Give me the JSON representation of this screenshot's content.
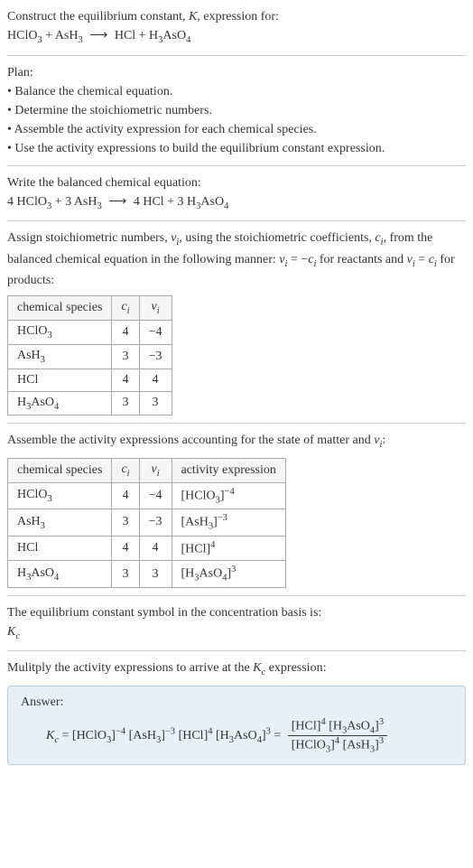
{
  "header": {
    "line1": "Construct the equilibrium constant, ",
    "K": "K",
    "line1b": ", expression for:",
    "eq_lhs": "HClO",
    "eq_sub1": "3",
    "eq_plus1": " + AsH",
    "eq_sub2": "3",
    "arrow": "⟶",
    "eq_rhs1": "HCl + H",
    "eq_sub3": "3",
    "eq_rhs2": "AsO",
    "eq_sub4": "4"
  },
  "plan": {
    "title": "Plan:",
    "b1": "• Balance the chemical equation.",
    "b2": "• Determine the stoichiometric numbers.",
    "b3": "• Assemble the activity expression for each chemical species.",
    "b4": "• Use the activity expressions to build the equilibrium constant expression."
  },
  "balanced": {
    "title": "Write the balanced chemical equation:",
    "c1": "4 HClO",
    "s1": "3",
    "c2": " + 3 AsH",
    "s2": "3",
    "arrow": "⟶",
    "c3": "4 HCl + 3 H",
    "s3": "3",
    "c4": "AsO",
    "s4": "4"
  },
  "assign": {
    "p1a": "Assign stoichiometric numbers, ",
    "nu": "ν",
    "isub": "i",
    "p1b": ", using the stoichiometric coefficients, ",
    "c": "c",
    "p1c": ", from the balanced chemical equation in the following manner: ",
    "eq1a": " = −",
    "p1d": " for reactants and ",
    "eq2a": " = ",
    "p1e": " for products:"
  },
  "table1": {
    "h1": "chemical species",
    "h2": "c",
    "h2sub": "i",
    "h3": "ν",
    "h3sub": "i",
    "r1": {
      "sp": "HClO",
      "spsub": "3",
      "c": "4",
      "n": "−4"
    },
    "r2": {
      "sp": "AsH",
      "spsub": "3",
      "c": "3",
      "n": "−3"
    },
    "r3": {
      "sp": "HCl",
      "spsub": "",
      "c": "4",
      "n": "4"
    },
    "r4": {
      "sp": "H",
      "spsub": "3",
      "sp2": "AsO",
      "spsub2": "4",
      "c": "3",
      "n": "3"
    }
  },
  "assemble": {
    "text": "Assemble the activity expressions accounting for the state of matter and ",
    "nu": "ν",
    "isub": "i",
    "colon": ":"
  },
  "table2": {
    "h1": "chemical species",
    "h2": "c",
    "h2sub": "i",
    "h3": "ν",
    "h3sub": "i",
    "h4": "activity expression",
    "r1": {
      "sp": "HClO",
      "spsub": "3",
      "c": "4",
      "n": "−4",
      "act": "[HClO",
      "actsub": "3",
      "act2": "]",
      "actsup": "−4"
    },
    "r2": {
      "sp": "AsH",
      "spsub": "3",
      "c": "3",
      "n": "−3",
      "act": "[AsH",
      "actsub": "3",
      "act2": "]",
      "actsup": "−3"
    },
    "r3": {
      "sp": "HCl",
      "spsub": "",
      "c": "4",
      "n": "4",
      "act": "[HCl]",
      "actsup": "4"
    },
    "r4": {
      "sp": "H",
      "spsub": "3",
      "sp2": "AsO",
      "spsub2": "4",
      "c": "3",
      "n": "3",
      "act": "[H",
      "actsub": "3",
      "act2": "AsO",
      "actsub2": "4",
      "act3": "]",
      "actsup": "3"
    }
  },
  "symbol": {
    "text": "The equilibrium constant symbol in the concentration basis is:",
    "K": "K",
    "csub": "c"
  },
  "multiply": {
    "text": "Mulitply the activity expressions to arrive at the ",
    "K": "K",
    "csub": "c",
    "text2": " expression:"
  },
  "answer": {
    "label": "Answer:",
    "K": "K",
    "csub": "c",
    "eq": " = [HClO",
    "s1": "3",
    "p1": "]",
    "e1": "−4",
    "sp1": " [AsH",
    "s2": "3",
    "p2": "]",
    "e2": "−3",
    "sp2": " [HCl]",
    "e3": "4",
    "sp3": " [H",
    "s3": "3",
    "sp4": "AsO",
    "s4": "4",
    "p3": "]",
    "e4": "3",
    "eqsign": " = ",
    "num1": "[HCl]",
    "nume1": "4",
    "num2": " [H",
    "nums1": "3",
    "num3": "AsO",
    "nums2": "4",
    "num4": "]",
    "nume2": "3",
    "den1": "[HClO",
    "dens1": "3",
    "den2": "]",
    "dene1": "4",
    "den3": " [AsH",
    "dens2": "3",
    "den4": "]",
    "dene2": "3"
  }
}
